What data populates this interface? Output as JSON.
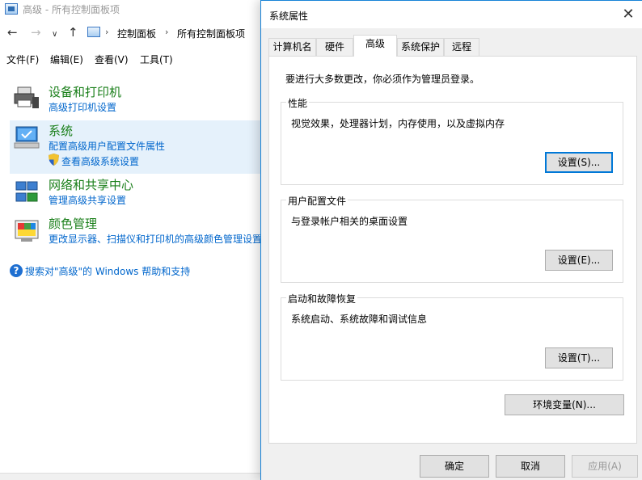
{
  "control_panel": {
    "window_title": "高级 - 所有控制面板项",
    "address": {
      "crumbs": [
        "控制面板",
        "所有控制面板项"
      ]
    },
    "menu": [
      "文件(F)",
      "编辑(E)",
      "查看(V)",
      "工具(T)"
    ],
    "categories": [
      {
        "title": "设备和打印机",
        "links": [
          "高级打印机设置"
        ],
        "icon": "printer-icon",
        "selected": false
      },
      {
        "title": "系统",
        "links": [
          "配置高级用户配置文件属性",
          "查看高级系统设置"
        ],
        "icon": "computer-icon",
        "selected": true
      },
      {
        "title": "网络和共享中心",
        "links": [
          "管理高级共享设置"
        ],
        "icon": "network-icon",
        "selected": false
      },
      {
        "title": "颜色管理",
        "links": [
          "更改显示器、扫描仪和打印机的高级颜色管理设置"
        ],
        "icon": "color-management-icon",
        "selected": false
      }
    ],
    "help_link": "搜索对\"高级\"的 Windows 帮助和支持"
  },
  "dialog": {
    "title": "系统属性",
    "tabs": [
      "计算机名",
      "硬件",
      "高级",
      "系统保护",
      "远程"
    ],
    "active_tab": "高级",
    "admin_note": "要进行大多数更改，你必须作为管理员登录。",
    "groups": [
      {
        "label": "性能",
        "description": "视觉效果，处理器计划，内存使用，以及虚拟内存",
        "button": "设置(S)..."
      },
      {
        "label": "用户配置文件",
        "description": "与登录帐户相关的桌面设置",
        "button": "设置(E)..."
      },
      {
        "label": "启动和故障恢复",
        "description": "系统启动、系统故障和调试信息",
        "button": "设置(T)..."
      }
    ],
    "env_button": "环境变量(N)...",
    "ok_button": "确定",
    "cancel_button": "取消",
    "apply_button": "应用(A)"
  },
  "colors": {
    "category_title": "#1a7f1a",
    "link": "#0066cc",
    "selected_row": "#e5f1fb",
    "focus_border": "#0078d7",
    "dialog_border": "#1883d7"
  }
}
